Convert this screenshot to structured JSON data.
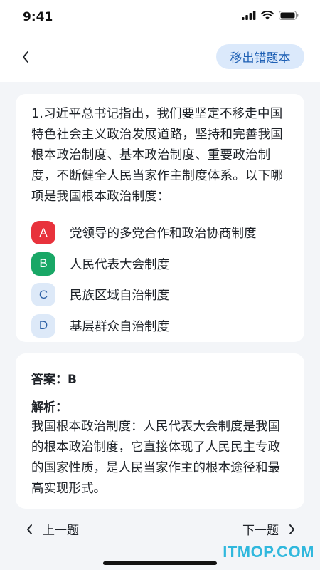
{
  "status": {
    "time": "9:41"
  },
  "header": {
    "back_icon": "chevron-left-icon",
    "remove_label": "移出错题本"
  },
  "question": {
    "text": "1.习近平总书记指出，我们要坚定不移走中国特色社会主义政治发展道路，坚持和完善我国根本政治制度、基本政治制度、重要政治制度，不断健全人民当家作主制度体系。以下哪项是我国根本政治制度：",
    "options": [
      {
        "letter": "A",
        "label": "党领导的多党合作和政治协商制度",
        "state": "wrong",
        "bg": "#e8323c",
        "fg": "#ffffff"
      },
      {
        "letter": "B",
        "label": "人民代表大会制度",
        "state": "correct",
        "bg": "#19a766",
        "fg": "#ffffff"
      },
      {
        "letter": "C",
        "label": "民族区域自治制度",
        "state": "neutral",
        "bg": "#dde9f8",
        "fg": "#2b5fa5"
      },
      {
        "letter": "D",
        "label": "基层群众自治制度",
        "state": "neutral",
        "bg": "#dde9f8",
        "fg": "#2b5fa5"
      }
    ]
  },
  "answer": {
    "line": "答案：B",
    "analysis_title": "解析：",
    "analysis_text": "我国根本政治制度：人民代表大会制度是我国的根本政治制度，它直接体现了人民民主专政的国家性质，是人民当家作主的根本途径和最高实现形式。"
  },
  "nav": {
    "prev_label": "上一题",
    "next_label": "下一题"
  },
  "watermark": "ITMOP.COM"
}
